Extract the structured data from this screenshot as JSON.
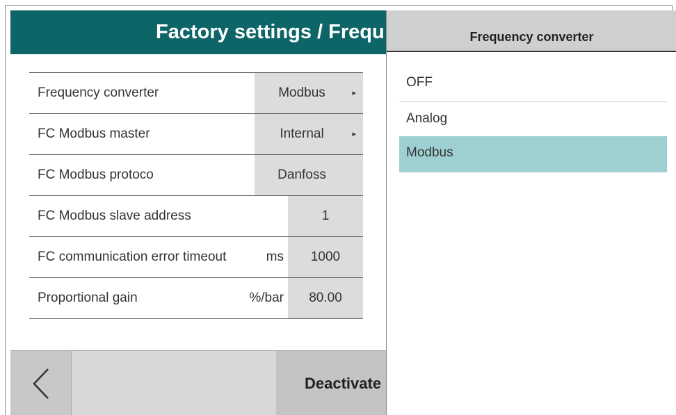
{
  "header": {
    "title": "Factory settings / Frequ"
  },
  "settings": {
    "rows": [
      {
        "label": "Frequency converter",
        "value": "Modbus",
        "unit": ""
      },
      {
        "label": "FC Modbus master",
        "value": "Internal",
        "unit": ""
      },
      {
        "label": "FC Modbus protoco",
        "value": "Danfoss",
        "unit": ""
      },
      {
        "label": "FC Modbus slave address",
        "value": "1",
        "unit": ""
      },
      {
        "label": "FC communication error timeout",
        "value": "1000",
        "unit": "ms"
      },
      {
        "label": "Proportional gain",
        "value": "80.00",
        "unit": "%/bar"
      }
    ],
    "arrow_glyph": "▸"
  },
  "footer": {
    "deactivate_label": "Deactivate"
  },
  "dropdown": {
    "title": "Frequency converter",
    "options": [
      "OFF",
      "Analog",
      "Modbus"
    ],
    "selected": "Modbus"
  },
  "colors": {
    "header_bg": "#0d6567",
    "selected_bg": "#9ed0d1",
    "value_bg": "#dcdcdc"
  }
}
